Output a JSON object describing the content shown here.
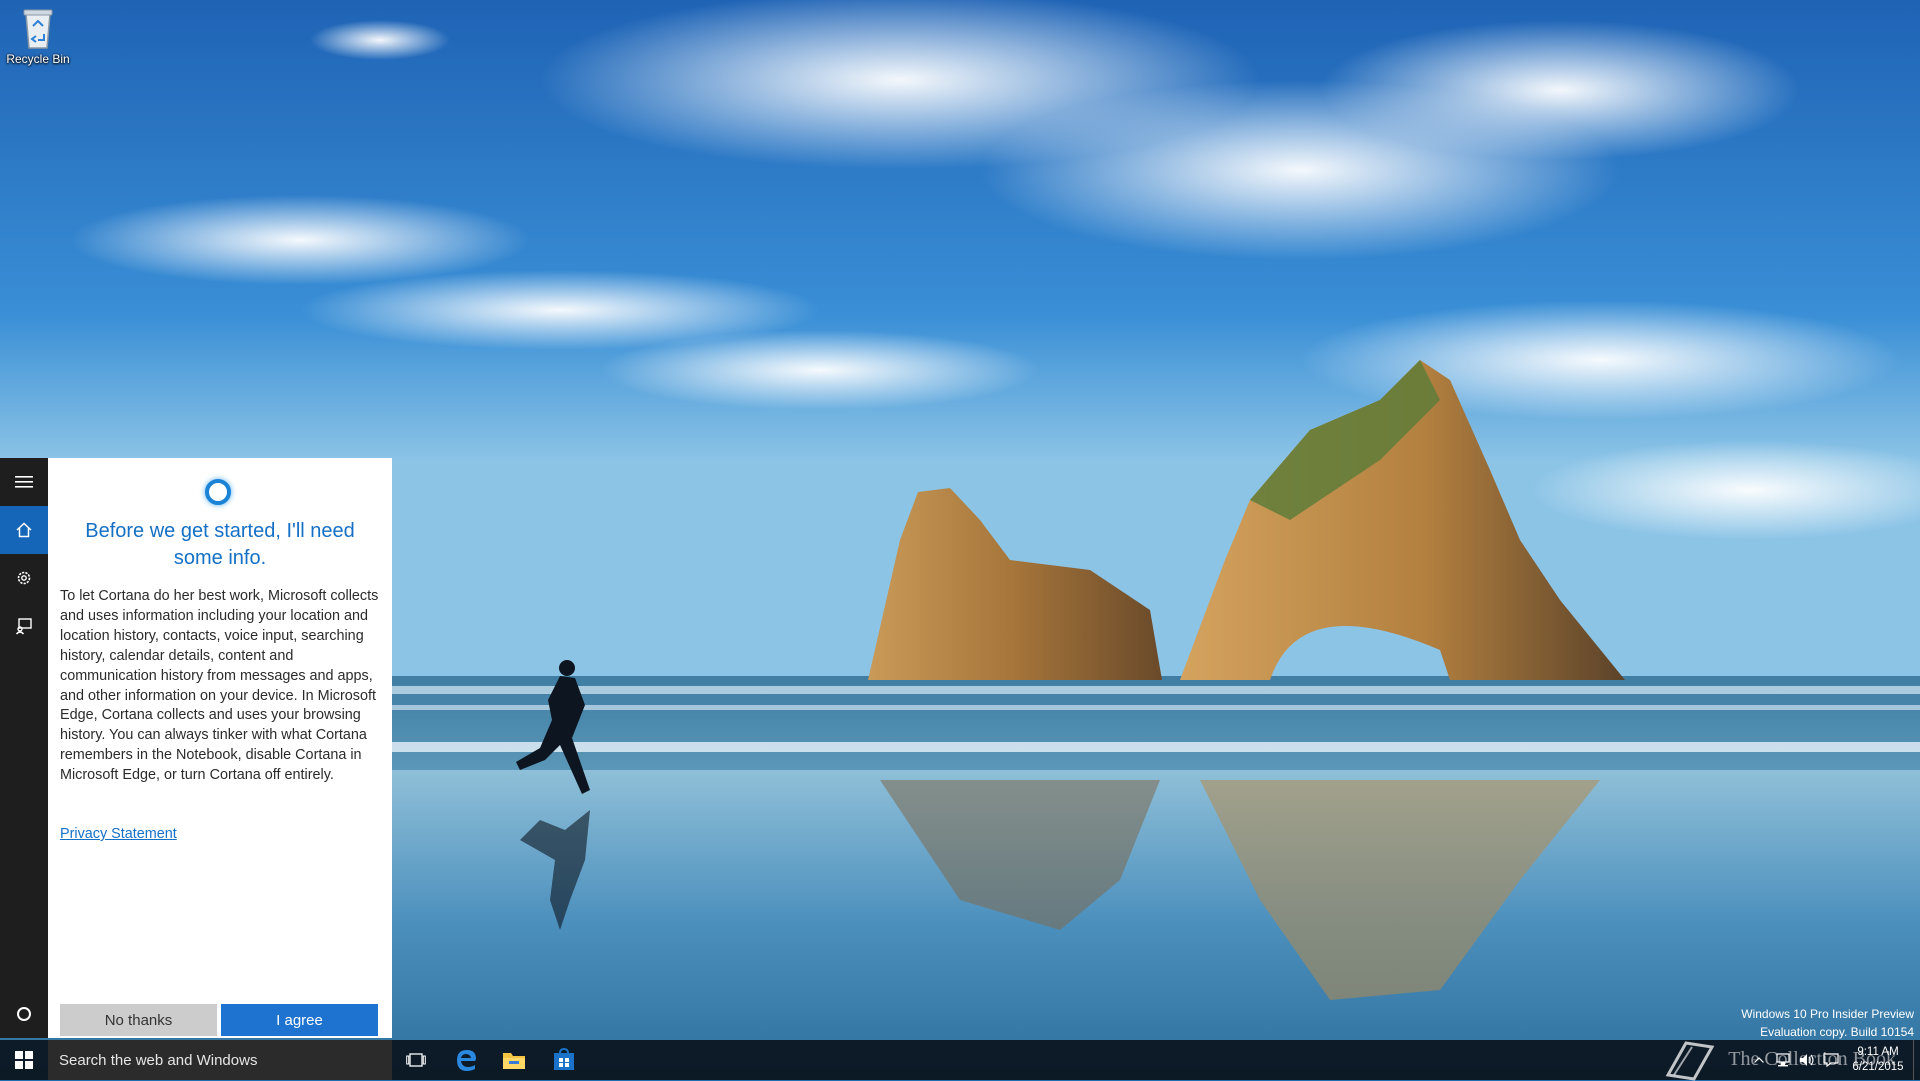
{
  "desktop": {
    "recycle_bin_label": "Recycle Bin"
  },
  "cortana": {
    "title": "Before we get started, I'll need some info.",
    "body": "To let Cortana do her best work, Microsoft collects and uses information including your location and location history, contacts, voice input, searching history, calendar details, content and communication history from messages and apps, and other information on your device. In Microsoft Edge, Cortana collects and uses your browsing history. You can always tinker with what Cortana remembers in the Notebook, disable Cortana in Microsoft Edge, or turn Cortana off entirely.",
    "privacy_link": "Privacy Statement",
    "no_thanks_label": "No thanks",
    "agree_label": "I agree",
    "rail_icons": [
      "hamburger-icon",
      "home-icon",
      "gear-icon",
      "feedback-icon",
      "cortana-circle-icon"
    ]
  },
  "taskbar": {
    "search_placeholder": "Search the web and Windows",
    "pinned": [
      "task-view-icon",
      "edge-icon",
      "file-explorer-icon",
      "store-icon"
    ],
    "tray_icons": [
      "chevron-up-icon",
      "network-icon",
      "volume-icon",
      "action-center-icon"
    ],
    "clock_time": "9:11 AM",
    "clock_date": "6/21/2015"
  },
  "watermark": {
    "edition": "Windows 10 Pro Insider Preview",
    "build": "Evaluation copy. Build 10154",
    "overlay_text": "The Collection Book"
  },
  "colors": {
    "accent": "#1f73d0",
    "title_blue": "#1570c6",
    "rail_bg": "#1e1e1e",
    "search_bg": "#2b2b2b"
  }
}
